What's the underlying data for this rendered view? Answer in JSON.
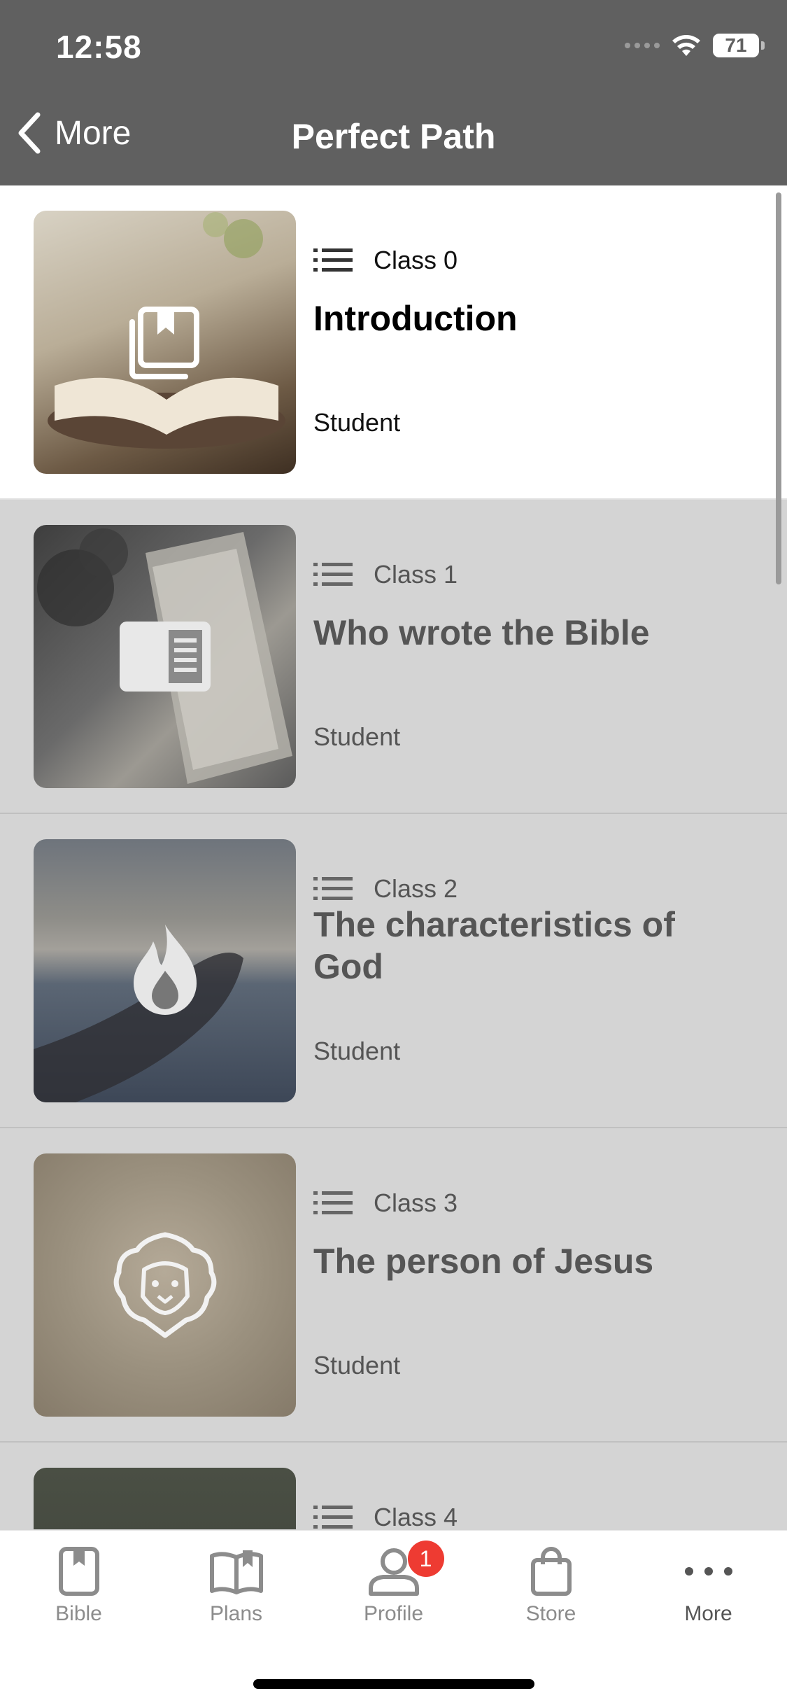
{
  "status_bar": {
    "time": "12:58",
    "battery": "71"
  },
  "nav": {
    "back_label": "More",
    "title": "Perfect Path"
  },
  "lessons": [
    {
      "class_label": "Class 0",
      "title": "Introduction",
      "author": "Student",
      "icon": "bookmark-book-icon"
    },
    {
      "class_label": "Class 1",
      "title": "Who wrote the Bible",
      "author": "Student",
      "icon": "reading-icon"
    },
    {
      "class_label": "Class 2",
      "title": "The characteristics of God",
      "author": "Student",
      "icon": "flame-icon"
    },
    {
      "class_label": "Class 3",
      "title": "The person of Jesus",
      "author": "Student",
      "icon": "lion-icon"
    },
    {
      "class_label": "Class 4",
      "title": "",
      "author": "",
      "icon": ""
    }
  ],
  "tabbar": {
    "tabs": [
      {
        "label": "Bible",
        "icon": "bible-icon"
      },
      {
        "label": "Plans",
        "icon": "plans-icon"
      },
      {
        "label": "Profile",
        "icon": "profile-icon",
        "badge": "1"
      },
      {
        "label": "Store",
        "icon": "store-icon"
      },
      {
        "label": "More",
        "icon": "more-icon"
      }
    ]
  },
  "colors": {
    "header": "#606060",
    "badge": "#ee3b32",
    "active_row": "#ffffff",
    "dimmed_row": "#d4d4d4"
  }
}
